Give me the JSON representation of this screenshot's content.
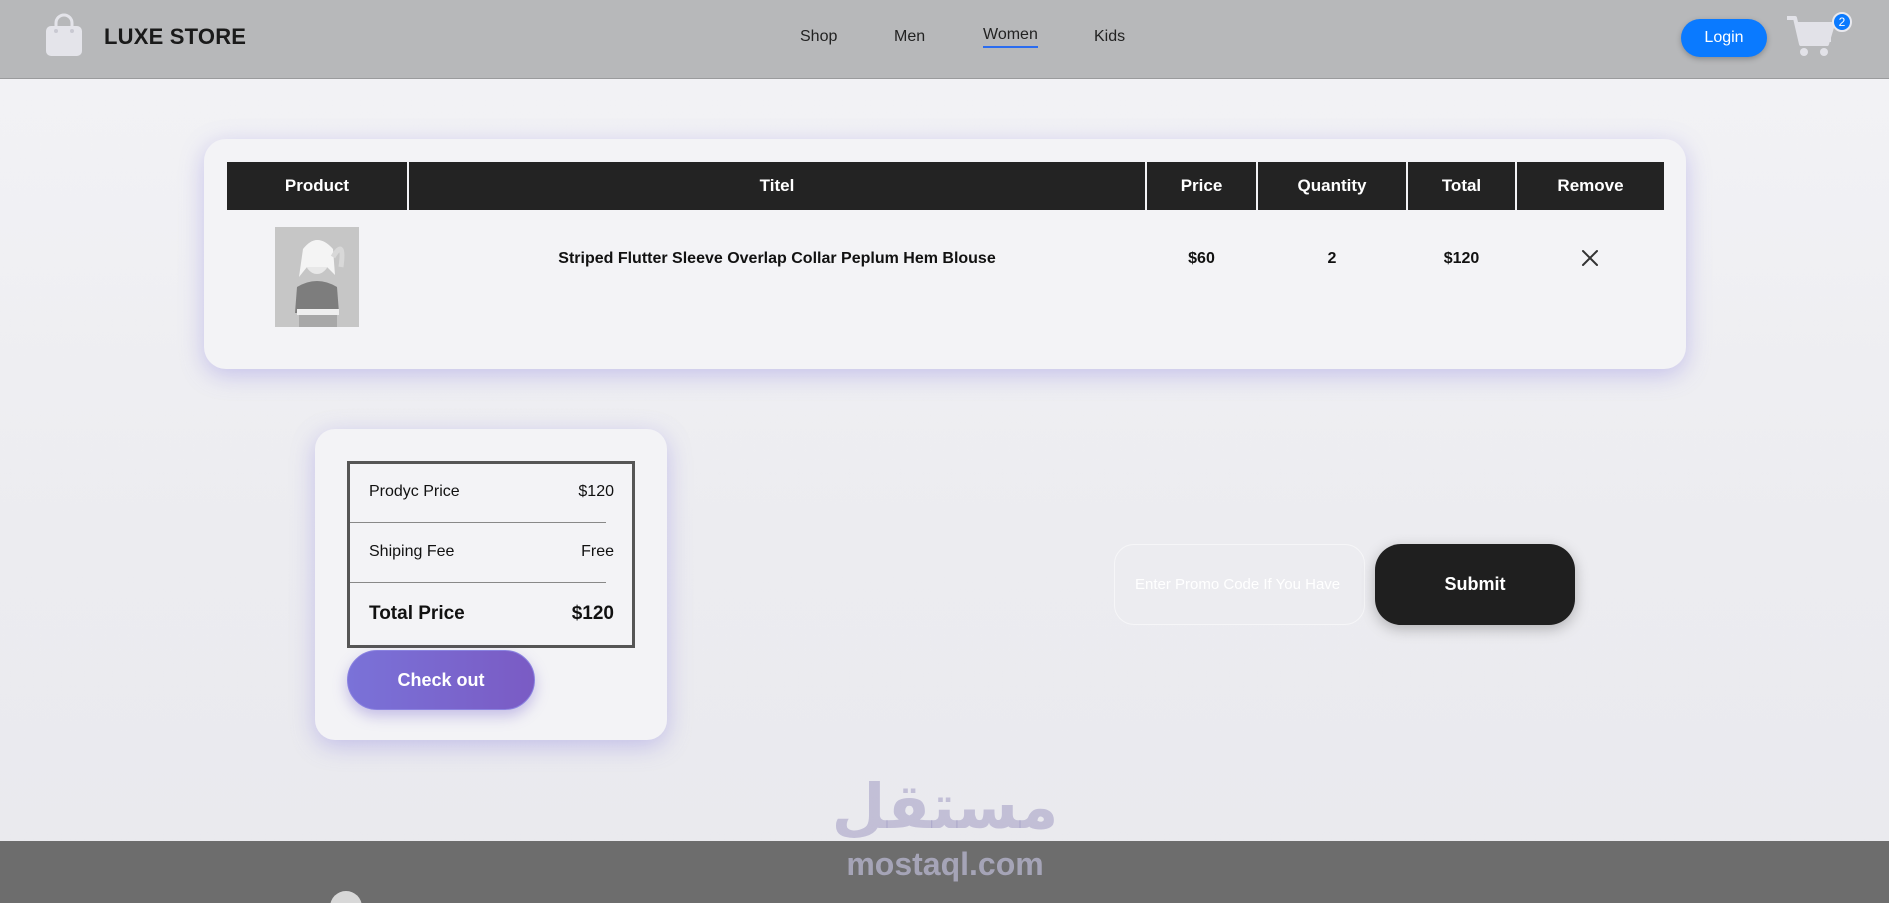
{
  "header": {
    "brand": "LUXE STORE",
    "nav": [
      "Shop",
      "Men",
      "Women",
      "Kids"
    ],
    "active_nav": "Women",
    "login_label": "Login",
    "cart_count": "2"
  },
  "cart_table": {
    "columns": [
      "Product",
      "Titel",
      "Price",
      "Quantity",
      "Total",
      "Remove"
    ],
    "rows": [
      {
        "title": "Striped Flutter Sleeve Overlap Collar Peplum Hem Blouse",
        "price": "$60",
        "quantity": "2",
        "total": "$120",
        "remove_icon": "close-icon"
      }
    ]
  },
  "summary": {
    "product_price_label": "Prodyc Price",
    "product_price_value": "$120",
    "shipping_label": "Shiping Fee",
    "shipping_value": "Free",
    "total_label": "Total Price",
    "total_value": "$120",
    "checkout_label": "Check out"
  },
  "promo": {
    "placeholder": "Enter Promo Code If You Have",
    "submit_label": "Submit"
  },
  "watermark": {
    "arabic": "مستقل",
    "latin": "mostaql.com"
  },
  "colors": {
    "accent_blue": "#0a7aff",
    "dark": "#232323",
    "checkout_gradient_start": "#7a72d8",
    "checkout_gradient_end": "#7a5bc4"
  }
}
